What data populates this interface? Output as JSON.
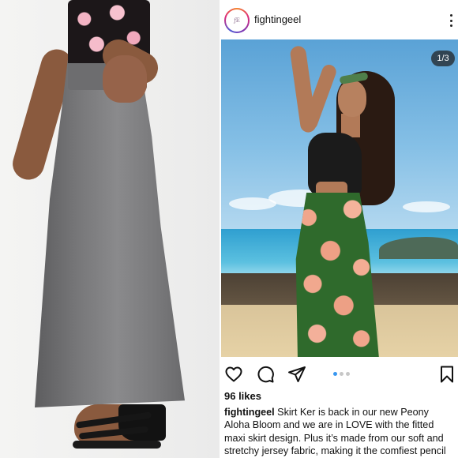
{
  "post": {
    "username": "fightingeel",
    "avatar_text": "ƒE",
    "image_counter": "1/3",
    "carousel": {
      "total": 3,
      "active_index": 0
    },
    "likes": "96 likes",
    "caption_user": "fightingeel",
    "caption_text": " Skirt Ker is back in our new Peony Aloha Bloom and we are in LOVE with the fitted maxi skirt design. Plus it’s made from our soft and stretchy jersey fabric, making it the comfiest pencil skirt ever!",
    "icons": {
      "like": "heart-icon",
      "comment": "comment-icon",
      "share": "share-icon",
      "save": "bookmark-icon",
      "more": "more-icon"
    }
  },
  "colors": {
    "text": "#111111",
    "active_dot": "#3897f0",
    "inactive_dot": "#c7c7c7"
  }
}
